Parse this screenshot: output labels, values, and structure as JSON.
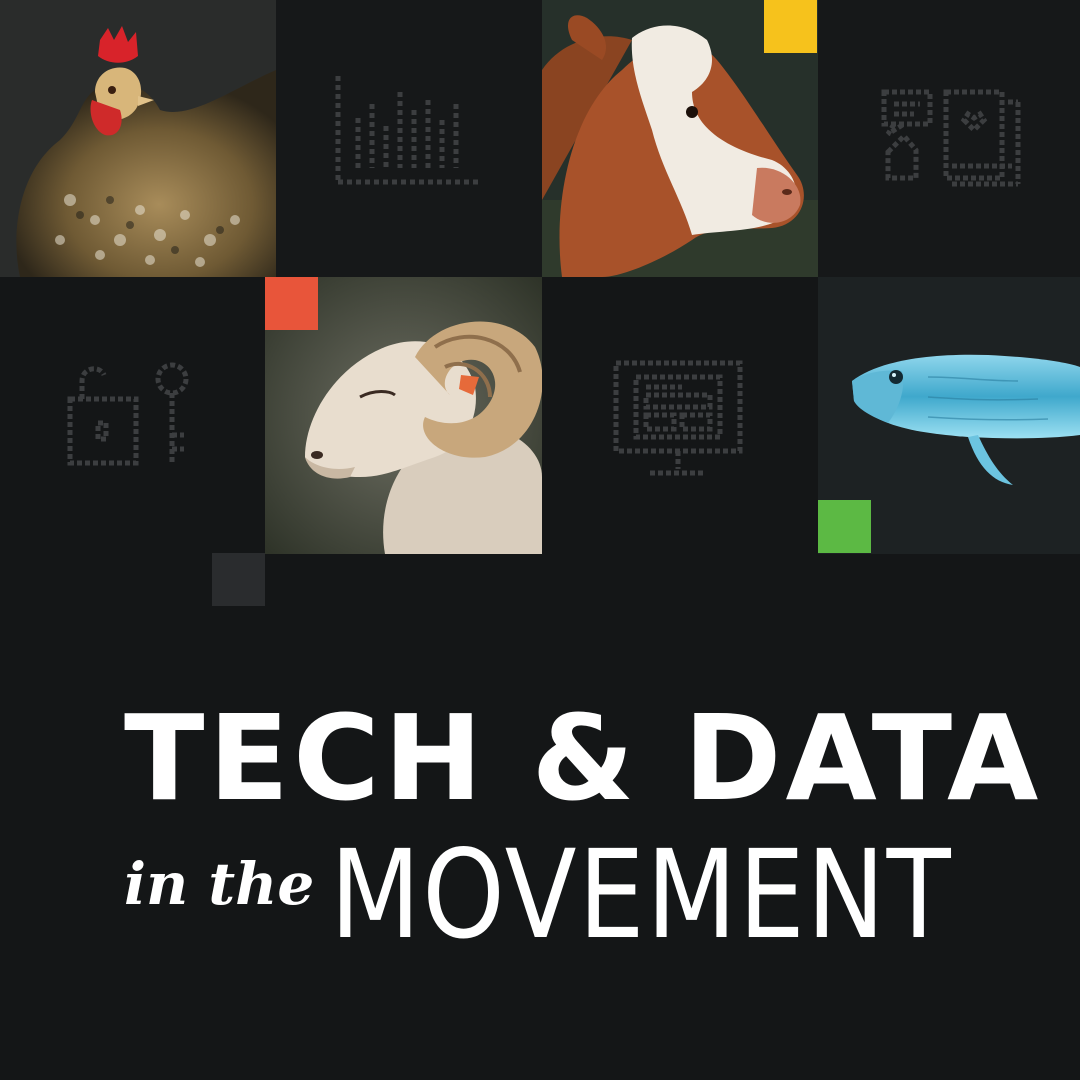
{
  "title": {
    "line1": "TECH & DATA",
    "line2_prefix": "in the",
    "line2_main": "MOVEMENT"
  },
  "tiles": [
    {
      "name": "chicken-photo"
    },
    {
      "name": "bar-chart-icon"
    },
    {
      "name": "cow-photo"
    },
    {
      "name": "chat-heart-book-icon"
    },
    {
      "name": "lock-key-icon"
    },
    {
      "name": "ram-photo"
    },
    {
      "name": "monitor-icon"
    },
    {
      "name": "fish-photo"
    }
  ],
  "colors": {
    "background": "#141617",
    "icon_gray": "#3c3e40",
    "accent_yellow": "#f6c21c",
    "accent_orange": "#e8553a",
    "accent_green": "#5cb944",
    "accent_gray": "#2a2c2e",
    "text": "#ffffff"
  }
}
